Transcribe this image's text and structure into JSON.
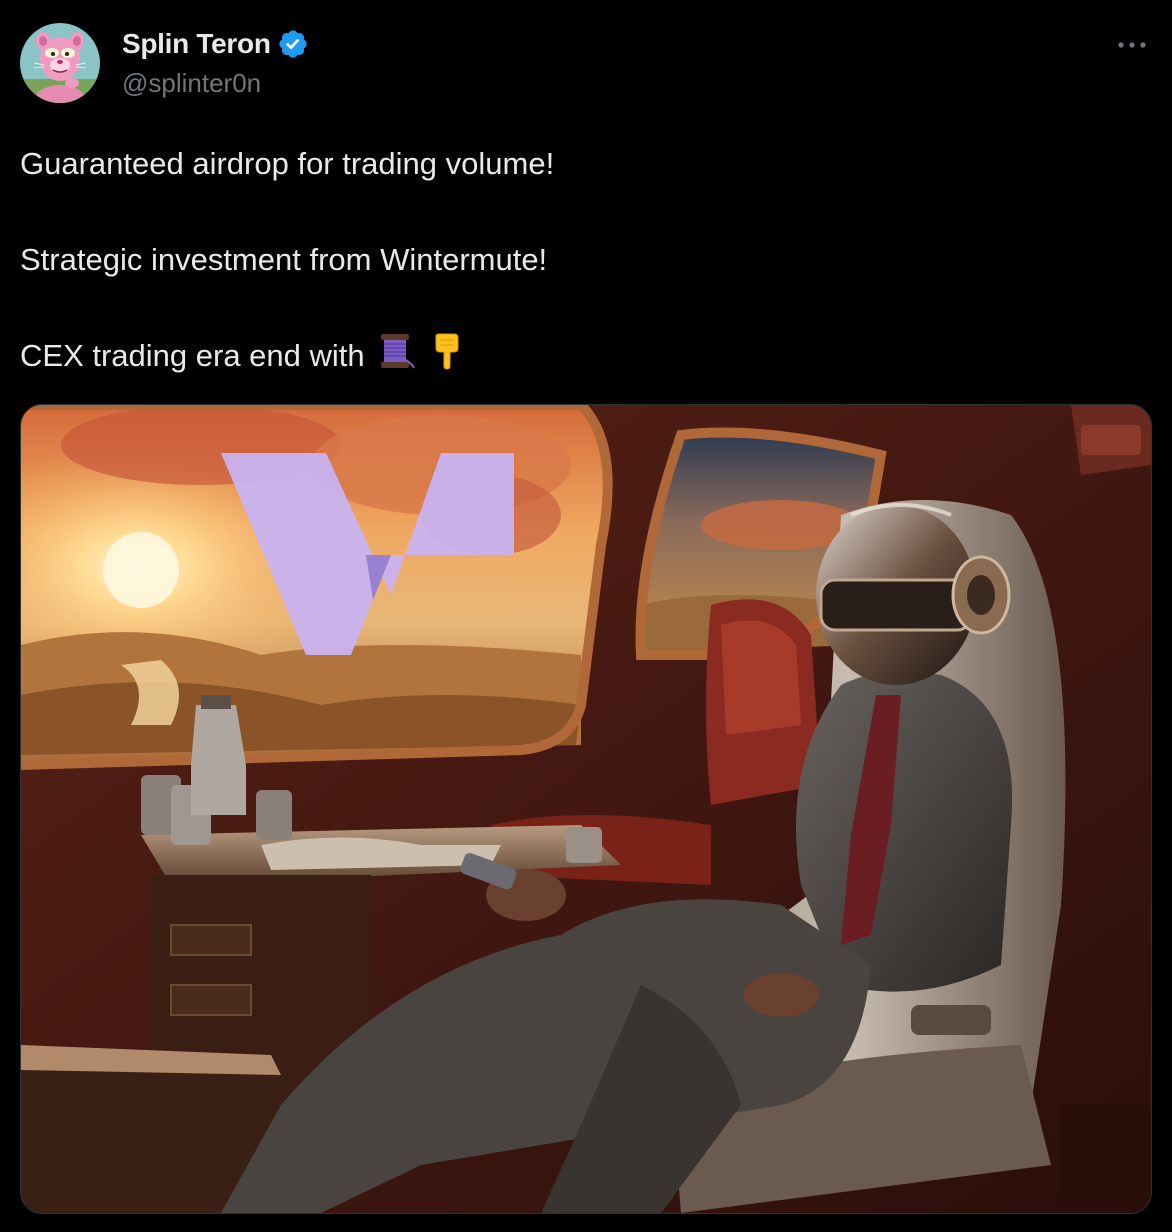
{
  "tweet": {
    "author": {
      "display_name": "Splin Teron",
      "handle": "@splinter0n",
      "verified": true,
      "avatar_icon": "pink-panther-avatar"
    },
    "more_icon": "more-horizontal-icon",
    "text_lines": [
      "Guaranteed airdrop for trading volume!",
      "",
      "Strategic investment from Wintermute!",
      "",
      "CEX trading era end with"
    ],
    "emojis": [
      "spool-of-thread-emoji",
      "pointing-down-emoji"
    ],
    "media": {
      "type": "image",
      "logo_color": "#c9b3f0",
      "icon": "airplane-cabin-illustration"
    }
  },
  "colors": {
    "background": "#000000",
    "text_primary": "#e7e9ea",
    "text_secondary": "#71767b",
    "verified_blue": "#1d9bf0",
    "media_border": "#2f3336"
  }
}
